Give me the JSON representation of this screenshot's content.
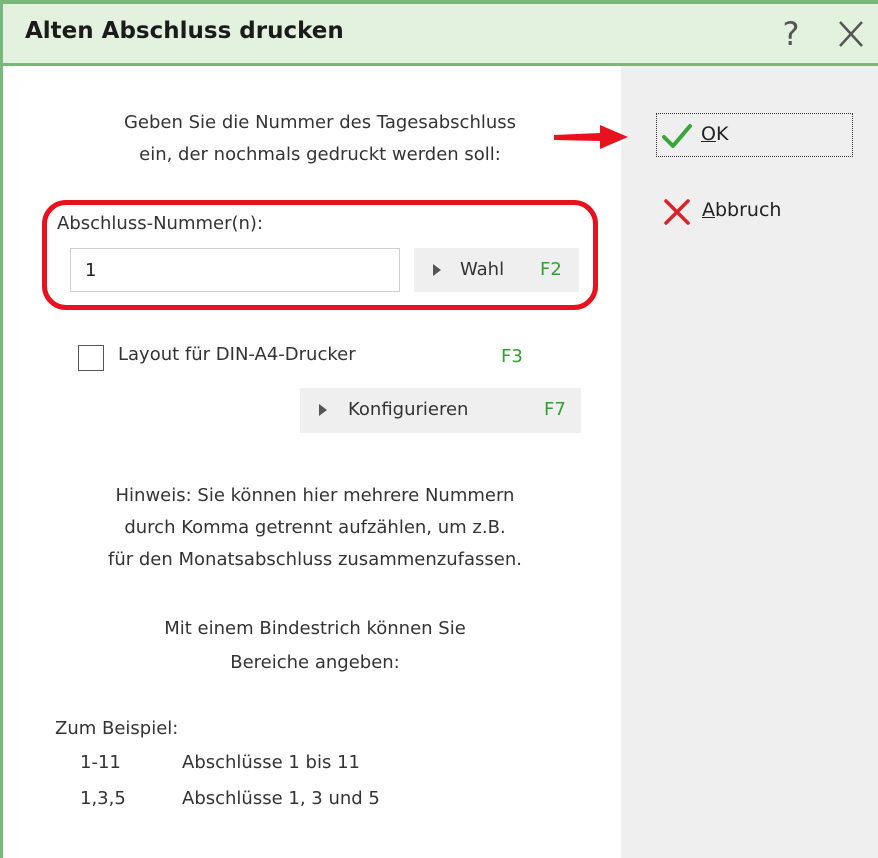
{
  "window": {
    "title": "Alten Abschluss drucken",
    "help_glyph": "?",
    "accent_color": "#79b87a",
    "title_bg": "#e3f1df"
  },
  "instruction": {
    "line1": "Geben Sie die Nummer des Tagesabschluss",
    "line2": "ein, der nochmals gedruckt werden soll:"
  },
  "field": {
    "label": "Abschluss-Nummer(n):",
    "value": "1"
  },
  "wahl_button": {
    "label": "Wahl",
    "key": "F2"
  },
  "layout_checkbox": {
    "label": "Layout für DIN-A4-Drucker",
    "key": "F3",
    "checked": false
  },
  "konfigurieren_button": {
    "label": "Konfigurieren",
    "key": "F7"
  },
  "hint": {
    "line1": "Hinweis: Sie können hier mehrere Nummern",
    "line2": "durch Komma getrennt aufzählen, um z.B.",
    "line3": "für den Monatsabschluss zusammenzufassen."
  },
  "range_hint": {
    "line1": "Mit einem Bindestrich können Sie",
    "line2": "Bereiche angeben:"
  },
  "examples": {
    "title": "Zum Beispiel:",
    "items": [
      {
        "code": "1-11",
        "desc": "Abschlüsse 1 bis 11"
      },
      {
        "code": "1,3,5",
        "desc": "Abschlüsse 1, 3 und 5"
      }
    ]
  },
  "ok_button": {
    "mnemonic": "O",
    "rest": "K"
  },
  "cancel_button": {
    "mnemonic": "A",
    "rest": "bbruch"
  },
  "icons": {
    "ok": "checkmark-icon",
    "cancel": "cross-icon",
    "help": "question-icon",
    "close": "close-icon",
    "pointer": "red-arrow-icon",
    "dropdown": "triangle-right-icon"
  },
  "colors": {
    "highlight": "#e8111e",
    "fkey": "#2ea12e",
    "checkmark": "#3aa53a",
    "cross": "#d8232a",
    "panel": "#efefef"
  }
}
